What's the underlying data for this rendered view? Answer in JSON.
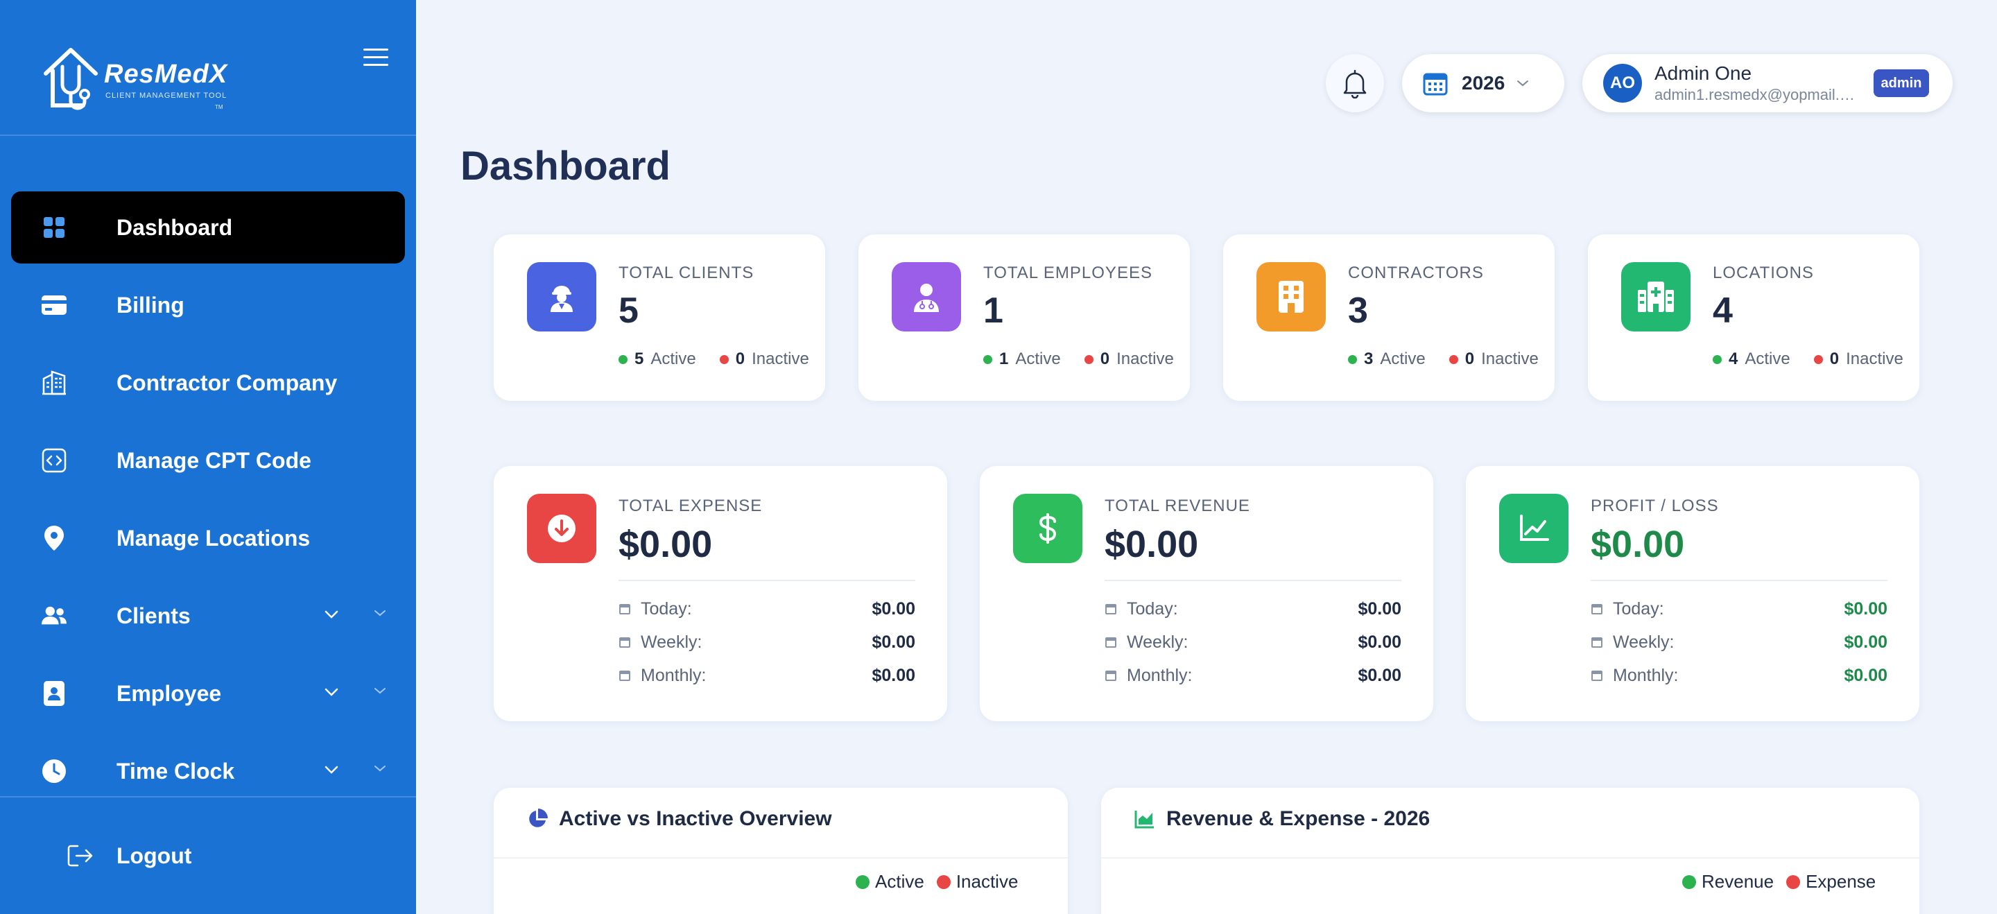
{
  "app": {
    "brand": "ResMedX",
    "tagline": "CLIENT MANAGEMENT TOOL",
    "tm": "TM"
  },
  "sidebar": {
    "items": [
      {
        "label": "Dashboard",
        "icon": "grid-icon",
        "active": true
      },
      {
        "label": "Billing",
        "icon": "credit-card-icon"
      },
      {
        "label": "Contractor Company",
        "icon": "building-icon"
      },
      {
        "label": "Manage CPT Code",
        "icon": "code-icon"
      },
      {
        "label": "Manage Locations",
        "icon": "location-pin-icon"
      },
      {
        "label": "Clients",
        "icon": "users-icon",
        "expandable": true
      },
      {
        "label": "Employee",
        "icon": "id-badge-icon",
        "expandable": true
      },
      {
        "label": "Time Clock",
        "icon": "clock-icon",
        "expandable": true
      }
    ],
    "logout": "Logout"
  },
  "header": {
    "year": "2026",
    "user": {
      "initials": "AO",
      "name": "Admin One",
      "email": "admin1.resmedx@yopmail.com",
      "role": "admin"
    }
  },
  "page": {
    "title": "Dashboard"
  },
  "stats": [
    {
      "title": "TOTAL CLIENTS",
      "value": "5",
      "active": "5",
      "inactive": "0",
      "color": "#4a63e0",
      "icon": "client-icon"
    },
    {
      "title": "TOTAL EMPLOYEES",
      "value": "1",
      "active": "1",
      "inactive": "0",
      "color": "#9a5ee8",
      "icon": "doctor-icon"
    },
    {
      "title": "CONTRACTORS",
      "value": "3",
      "active": "3",
      "inactive": "0",
      "color": "#f29a2a",
      "icon": "building-icon"
    },
    {
      "title": "LOCATIONS",
      "value": "4",
      "active": "4",
      "inactive": "0",
      "color": "#22b872",
      "icon": "hospital-icon"
    }
  ],
  "labels": {
    "active": "Active",
    "inactive": "Inactive",
    "today": "Today:",
    "weekly": "Weekly:",
    "monthly": "Monthly:"
  },
  "finance": [
    {
      "title": "TOTAL EXPENSE",
      "value": "$0.00",
      "today": "$0.00",
      "weekly": "$0.00",
      "monthly": "$0.00",
      "color": "#e84545",
      "icon": "arrow-down-circle-icon"
    },
    {
      "title": "TOTAL REVENUE",
      "value": "$0.00",
      "today": "$0.00",
      "weekly": "$0.00",
      "monthly": "$0.00",
      "color": "#2ebd5c",
      "icon": "dollar-icon"
    },
    {
      "title": "PROFIT / LOSS",
      "value": "$0.00",
      "today": "$0.00",
      "weekly": "$0.00",
      "monthly": "$0.00",
      "color": "#22b872",
      "icon": "trend-chart-icon"
    }
  ],
  "panels": {
    "overview": {
      "title": "Active vs Inactive Overview",
      "legend": [
        "Active",
        "Inactive"
      ]
    },
    "revenue": {
      "title": "Revenue & Expense - 2026",
      "legend": [
        "Revenue",
        "Expense"
      ]
    }
  },
  "colors": {
    "sidebar": "#1a73d4",
    "active_dot": "#2cb24f",
    "inactive_dot": "#e84545",
    "profit_text": "#1e8a4a"
  }
}
